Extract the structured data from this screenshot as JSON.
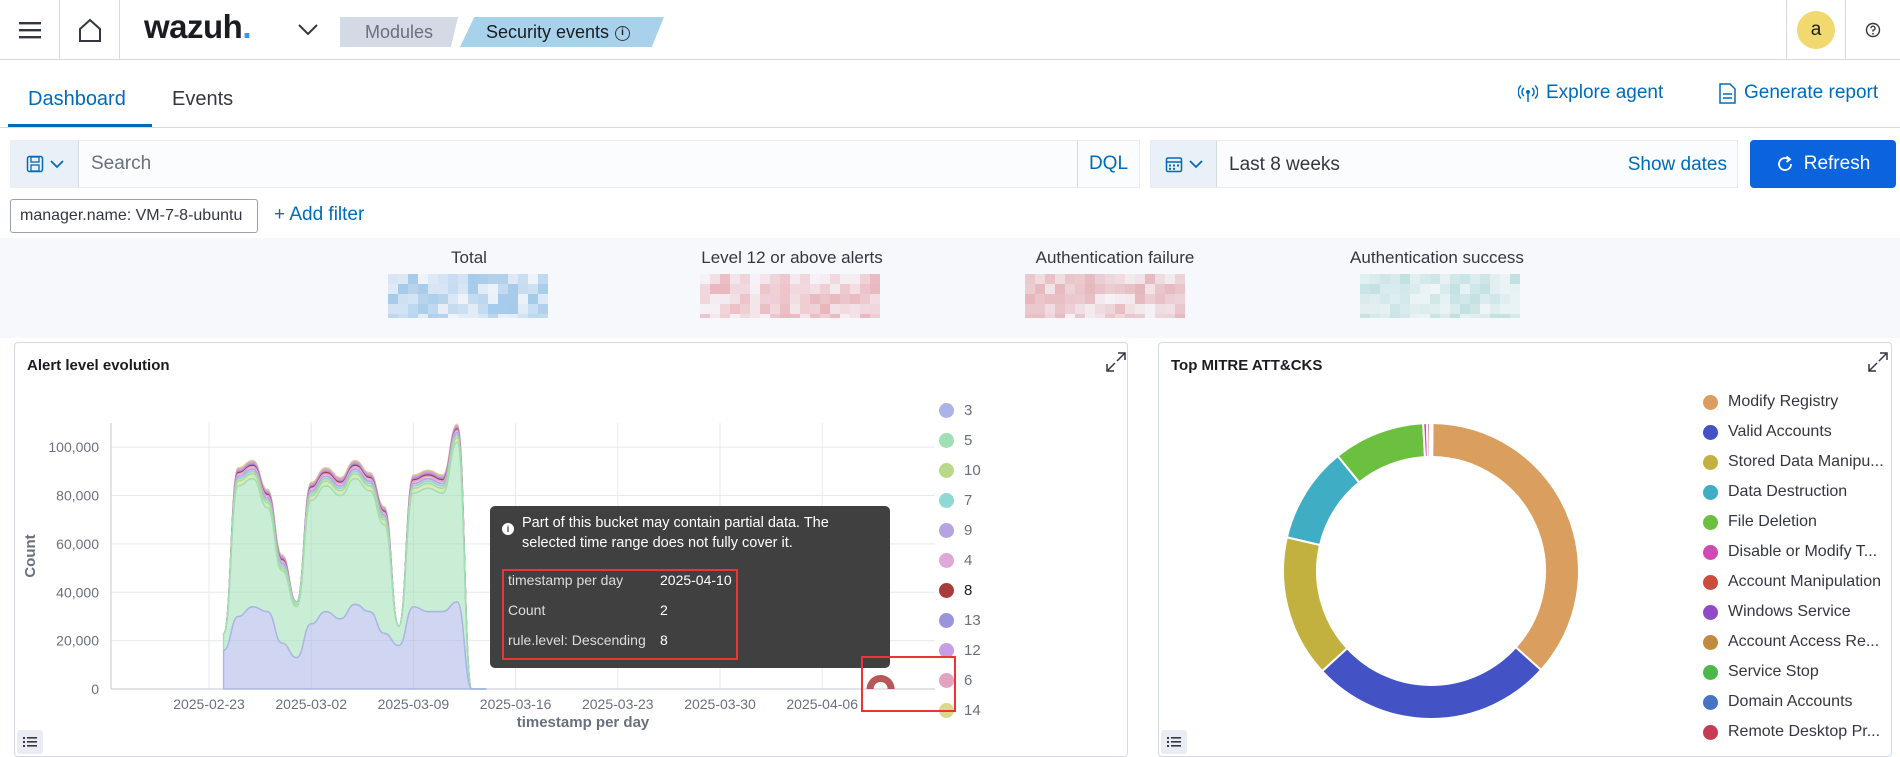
{
  "header": {
    "logo": "wazuh",
    "logo_dot": ".",
    "breadcrumbs": [
      "Modules",
      "Security events"
    ],
    "avatar_initial": "a",
    "icons": [
      "menu-icon",
      "home-icon",
      "chevron-down-icon",
      "info-icon",
      "help-icon"
    ]
  },
  "tabs": {
    "items": [
      "Dashboard",
      "Events"
    ],
    "active": "Dashboard",
    "explore_agent": "Explore agent",
    "generate_report": "Generate report"
  },
  "search": {
    "placeholder": "Search",
    "language": "DQL",
    "time_range": "Last 8 weeks",
    "show_dates": "Show dates",
    "refresh": "Refresh"
  },
  "filters": {
    "pill": "manager.name: VM-7-8-ubuntu",
    "add_filter": "+ Add filter"
  },
  "metrics": {
    "labels": [
      "Total",
      "Level 12 or above alerts",
      "Authentication failure",
      "Authentication success"
    ],
    "colors": [
      "#6aa8dc",
      "#e08b94",
      "#d98b92",
      "#9dd2cd"
    ]
  },
  "panels": {
    "alert_title": "Alert level evolution",
    "mitre_title": "Top MITRE ATT&CKS"
  },
  "chart_data": [
    {
      "type": "area",
      "title": "Alert level evolution",
      "xlabel": "timestamp per day",
      "ylabel": "Count",
      "x_ticks": [
        "2025-02-23",
        "2025-03-02",
        "2025-03-09",
        "2025-03-16",
        "2025-03-23",
        "2025-03-30",
        "2025-04-06"
      ],
      "y_ticks": [
        "0",
        "20,000",
        "40,000",
        "60,000",
        "80,000",
        "100,000"
      ],
      "ylim": [
        0,
        110000
      ],
      "x": [
        "2025-02-24",
        "2025-02-25",
        "2025-02-26",
        "2025-02-27",
        "2025-02-28",
        "2025-03-01",
        "2025-03-02",
        "2025-03-03",
        "2025-03-04",
        "2025-03-05",
        "2025-03-06",
        "2025-03-07",
        "2025-03-08",
        "2025-03-09",
        "2025-03-10",
        "2025-03-11",
        "2025-03-12",
        "2025-03-13",
        "2025-03-14"
      ],
      "series": [
        {
          "name": "3",
          "color": "#aab4e6",
          "values": [
            16000,
            30000,
            34000,
            32000,
            19000,
            13000,
            27000,
            32000,
            29000,
            35000,
            32000,
            23000,
            18000,
            34000,
            32000,
            32000,
            36000,
            0,
            0
          ]
        },
        {
          "name": "5",
          "color": "#9fdfb4",
          "values": [
            7000,
            54000,
            53000,
            43000,
            30000,
            21000,
            51000,
            52000,
            51000,
            52000,
            50000,
            45000,
            8000,
            47000,
            51000,
            49000,
            66000,
            0,
            0
          ]
        },
        {
          "name": "10",
          "color": "#b8d98a",
          "values": [
            0,
            2000,
            2000,
            2000,
            1000,
            1000,
            2000,
            2000,
            2000,
            2000,
            2000,
            2000,
            0,
            2000,
            2000,
            2000,
            2000,
            0,
            0
          ]
        },
        {
          "name": "7",
          "color": "#8fd9d2",
          "values": [
            0,
            1000,
            1000,
            1000,
            1000,
            1000,
            1000,
            1000,
            1000,
            1000,
            1000,
            1000,
            0,
            1000,
            1000,
            1000,
            1000,
            0,
            0
          ]
        },
        {
          "name": "9",
          "color": "#b6a4e0",
          "values": [
            0,
            1000,
            1000,
            1000,
            1000,
            0,
            1000,
            1000,
            1000,
            1000,
            1000,
            1000,
            0,
            1000,
            1000,
            1000,
            1000,
            0,
            0
          ]
        },
        {
          "name": "4",
          "color": "#e0a8d8",
          "values": [
            0,
            1000,
            1000,
            1000,
            1000,
            0,
            1000,
            1000,
            1000,
            1000,
            1000,
            1000,
            0,
            1000,
            1000,
            1000,
            1000,
            0,
            0
          ]
        },
        {
          "name": "8",
          "color": "#a93b3b",
          "values": [
            0,
            500,
            500,
            500,
            500,
            0,
            500,
            500,
            500,
            500,
            500,
            500,
            0,
            500,
            500,
            500,
            500,
            0,
            0
          ]
        },
        {
          "name": "13",
          "color": "#9a94dc",
          "values": [
            0,
            500,
            500,
            500,
            500,
            0,
            500,
            500,
            500,
            500,
            500,
            500,
            0,
            500,
            500,
            500,
            500,
            0,
            0
          ]
        },
        {
          "name": "12",
          "color": "#c79ee6",
          "values": [
            0,
            500,
            500,
            500,
            500,
            0,
            500,
            500,
            500,
            500,
            500,
            500,
            0,
            500,
            500,
            500,
            500,
            0,
            0
          ]
        },
        {
          "name": "6",
          "color": "#e2a3c0",
          "values": [
            0,
            500,
            500,
            500,
            500,
            0,
            500,
            500,
            500,
            500,
            500,
            500,
            0,
            500,
            500,
            500,
            500,
            0,
            0
          ]
        },
        {
          "name": "14",
          "color": "#d9d98e",
          "values": [
            0,
            500,
            500,
            500,
            500,
            0,
            500,
            500,
            500,
            500,
            500,
            500,
            0,
            500,
            500,
            500,
            500,
            0,
            0
          ]
        }
      ],
      "legend": "right",
      "grid": true,
      "tooltip": {
        "note": "Part of this bucket may contain partial data. The selected time range does not fully cover it.",
        "rows": [
          {
            "k": "timestamp per day",
            "v": "2025-04-10"
          },
          {
            "k": "Count",
            "v": "2"
          },
          {
            "k": "rule.level: Descending",
            "v": "8"
          }
        ]
      }
    },
    {
      "type": "pie",
      "title": "Top MITRE ATT&CKS",
      "legend": "right",
      "labels": [
        "Modify Registry",
        "Valid Accounts",
        "Stored Data Manipu...",
        "Data Destruction",
        "File Deletion",
        "Disable or Modify T...",
        "Account Manipulation",
        "Windows Service",
        "Account Access Re...",
        "Service Stop",
        "Domain Accounts",
        "Remote Desktop Pr..."
      ],
      "colors": [
        "#da9f5e",
        "#4353c6",
        "#c2b13f",
        "#3fadc4",
        "#6bc040",
        "#d04ab3",
        "#cc4d3e",
        "#8f4ac6",
        "#c28a3d",
        "#4bb84b",
        "#4774c6",
        "#c43d55"
      ],
      "values": [
        36.5,
        26.5,
        15.5,
        10.5,
        10.0,
        0.4,
        0.3,
        0.1,
        0.1,
        0.05,
        0.03,
        0.02
      ]
    }
  ]
}
